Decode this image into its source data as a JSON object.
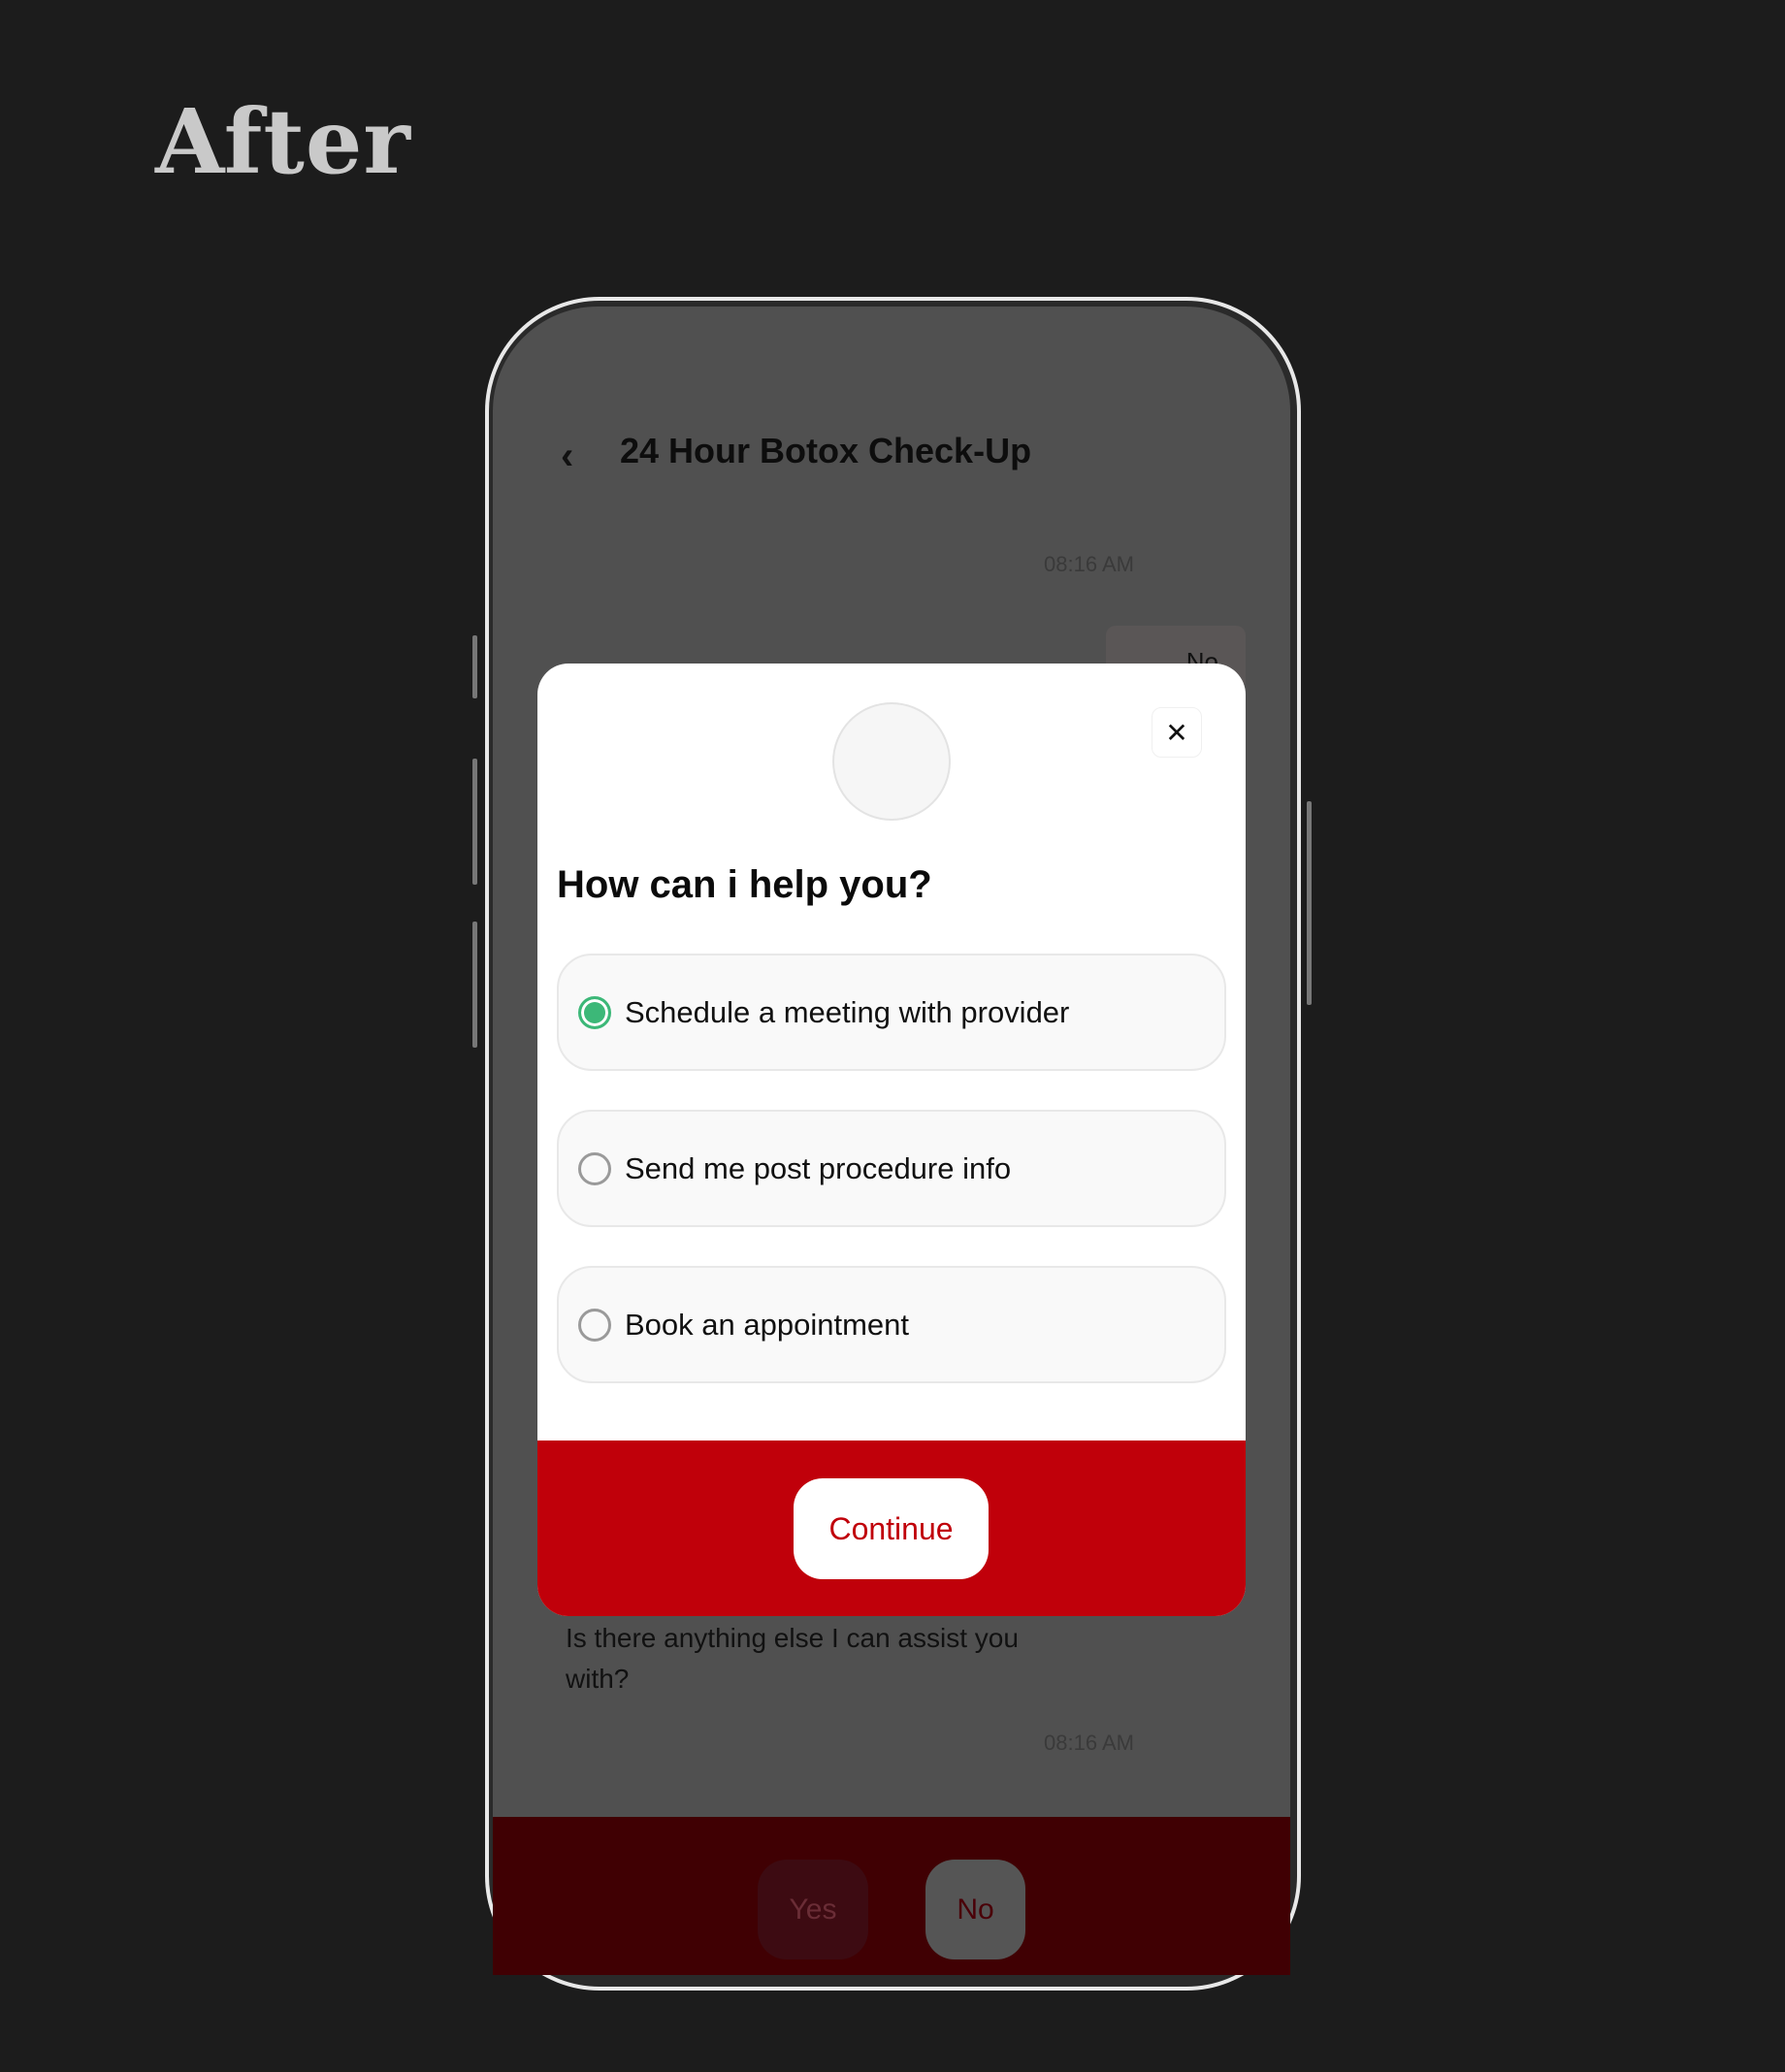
{
  "page_heading": "After",
  "header": {
    "back_icon": "chevron-left-icon",
    "title": "24 Hour Botox Check-Up"
  },
  "chat": {
    "timestamp_top": "08:16 AM",
    "user_bubble": "No",
    "bot_message": "Is there anything else I can assist you with?",
    "timestamp_bottom": "08:16 AM"
  },
  "quick_replies": [
    {
      "label": "Yes"
    },
    {
      "label": "No"
    }
  ],
  "modal": {
    "close_icon": "close-icon",
    "title": "How can i help you?",
    "options": [
      {
        "label": "Schedule a meeting with provider",
        "selected": true
      },
      {
        "label": "Send me post procedure info",
        "selected": false
      },
      {
        "label": "Book an appointment",
        "selected": false
      }
    ],
    "continue_label": "Continue"
  },
  "colors": {
    "accent_red": "#c0000a",
    "selected_green": "#3cb878",
    "background": "#1c1c1c"
  }
}
